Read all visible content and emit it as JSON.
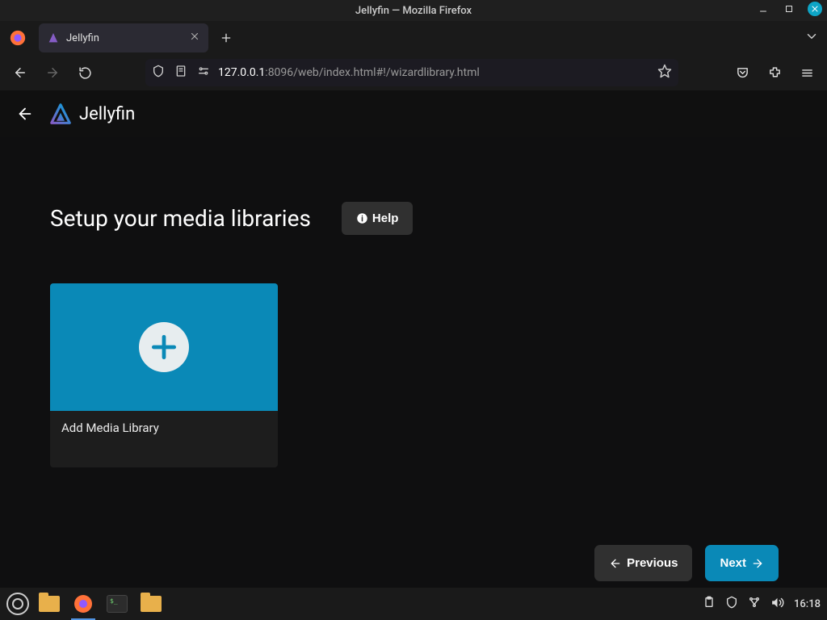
{
  "window": {
    "title": "Jellyfin — Mozilla Firefox"
  },
  "browser": {
    "tab_label": "Jellyfin",
    "url_host": "127.0.0.1",
    "url_path": ":8096/web/index.html#!/wizardlibrary.html"
  },
  "app": {
    "brand": "Jellyfin",
    "headline": "Setup your media libraries",
    "help_label": "Help",
    "card_label": "Add Media Library",
    "prev_label": "Previous",
    "next_label": "Next"
  },
  "taskbar": {
    "clock": "16:18"
  }
}
